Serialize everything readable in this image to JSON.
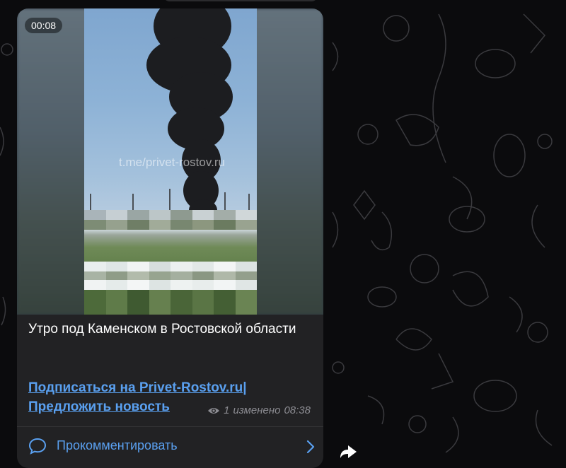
{
  "post": {
    "video": {
      "duration": "00:08",
      "watermark": "t.me/privet-rostov.ru"
    },
    "caption": "Утро под Каменском в Ростовской области",
    "links": {
      "subscribe": "Подписаться на Privet-Rostov.ru|",
      "suggest": "Предложить новость"
    },
    "meta": {
      "views": "1",
      "edited_label": "изменено",
      "time": "08:38"
    },
    "comment": {
      "label": "Прокомментировать"
    }
  },
  "icons": {
    "views": "eye-icon",
    "comment": "speech-bubble-icon",
    "chevron": "chevron-right-icon",
    "share": "share-arrow-icon"
  },
  "colors": {
    "link": "#5aa0f0",
    "bubble": "#222224",
    "background": "#0b0b0d",
    "meta": "#8c8c92"
  }
}
